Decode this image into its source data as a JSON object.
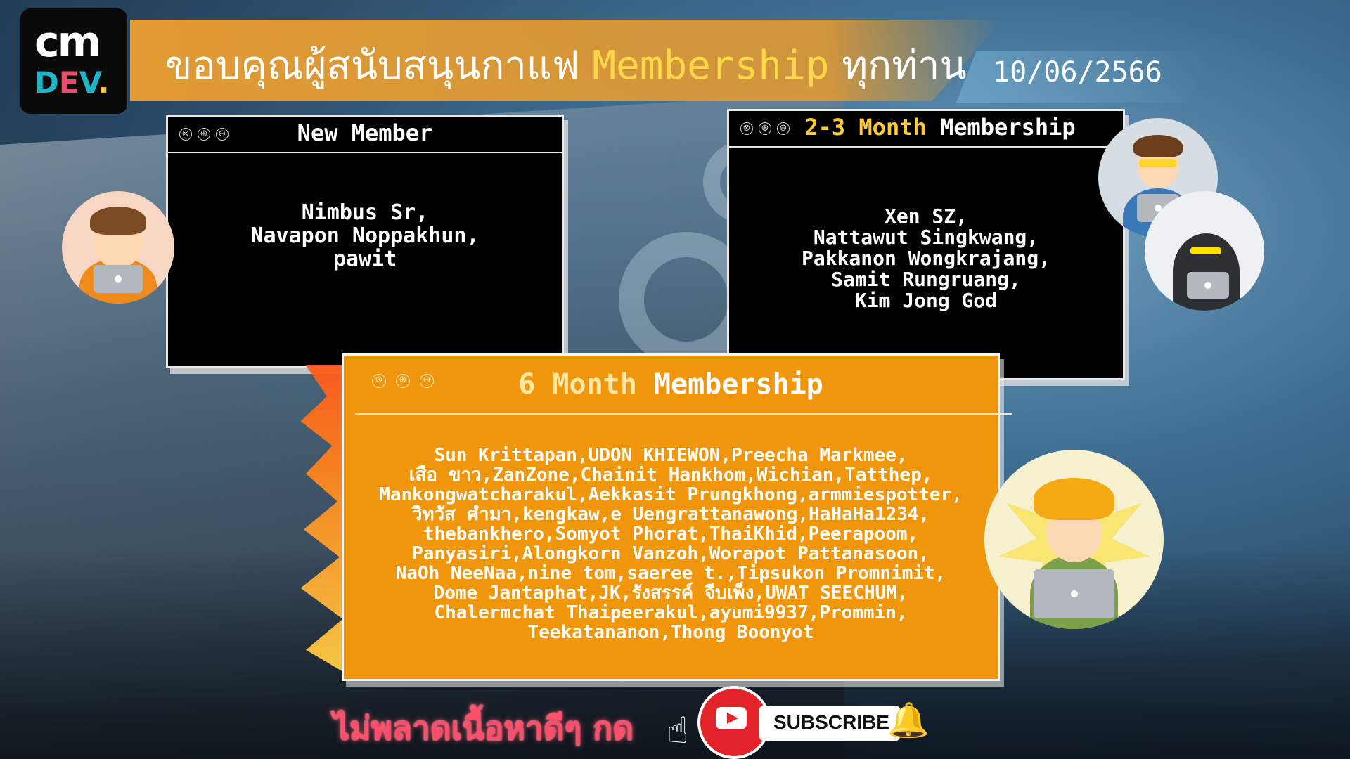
{
  "logo": {
    "line1": "cm",
    "line2": [
      "D",
      "E",
      "V",
      "."
    ]
  },
  "header": {
    "title_pre": "ขอบคุณผู้สนับสนุนกาแฟ ",
    "title_highlight": "Membership",
    "title_post": " ทุกท่าน",
    "date": "10/06/2566"
  },
  "windows": {
    "new_member": {
      "title": "New Member",
      "controls": [
        "⊗",
        "⊕",
        "⊖"
      ],
      "names": [
        "Nimbus Sr,",
        "Navapon Noppakhun,",
        "pawit"
      ]
    },
    "two_three_month": {
      "title_highlight": "2-3 Month",
      "title_rest": " Membership",
      "controls": [
        "⊗",
        "⊕",
        "⊖"
      ],
      "names": [
        "Xen SZ,",
        "Nattawut Singkwang,",
        "Pakkanon Wongkrajang,",
        "Samit Rungruang,",
        "Kim Jong God"
      ]
    },
    "six_month": {
      "title_highlight": "6 Month",
      "title_rest": " Membership",
      "controls": [
        "⊗",
        "⊕",
        "⊖"
      ],
      "names": [
        "Sun Krittapan,UDON KHIEWON,Preecha Markmee,",
        "เสือ ขาว,ZanZone,Chainit Hankhom,Wichian,Tatthep,",
        "Mankongwatcharakul,Aekkasit Prungkhong,armmiespotter,",
        "วิทวัส คำมา,kengkaw,e Uengrattanawong,HaHaHa1234,",
        "thebankhero,Somyot Phorat,ThaiKhid,Peerapoom,",
        "Panyasiri,Alongkorn Vanzoh,Worapot Pattanasoon,",
        "NaOh NeeNaa,nine tom,saeree t.,Tipsukon Promnimit,",
        "Dome Jantaphat,JK,รังสรรค์ จีบเพ็ง,UWAT SEECHUM,",
        "Chalermchat Thaipeerakul,ayumi9937,Prommin,",
        "Teekatananon,Thong Boonyot"
      ]
    }
  },
  "footer": {
    "cta_text": "ไม่พลาดเนื้อหาดีๆ กด",
    "subscribe_label": "SUBSCRIBE",
    "hand_icon": "☝",
    "bell_icon": "🔔"
  },
  "colors": {
    "accent_orange": "#f0960c",
    "highlight_yellow": "#ffc933",
    "youtube_red": "#e2232a"
  }
}
